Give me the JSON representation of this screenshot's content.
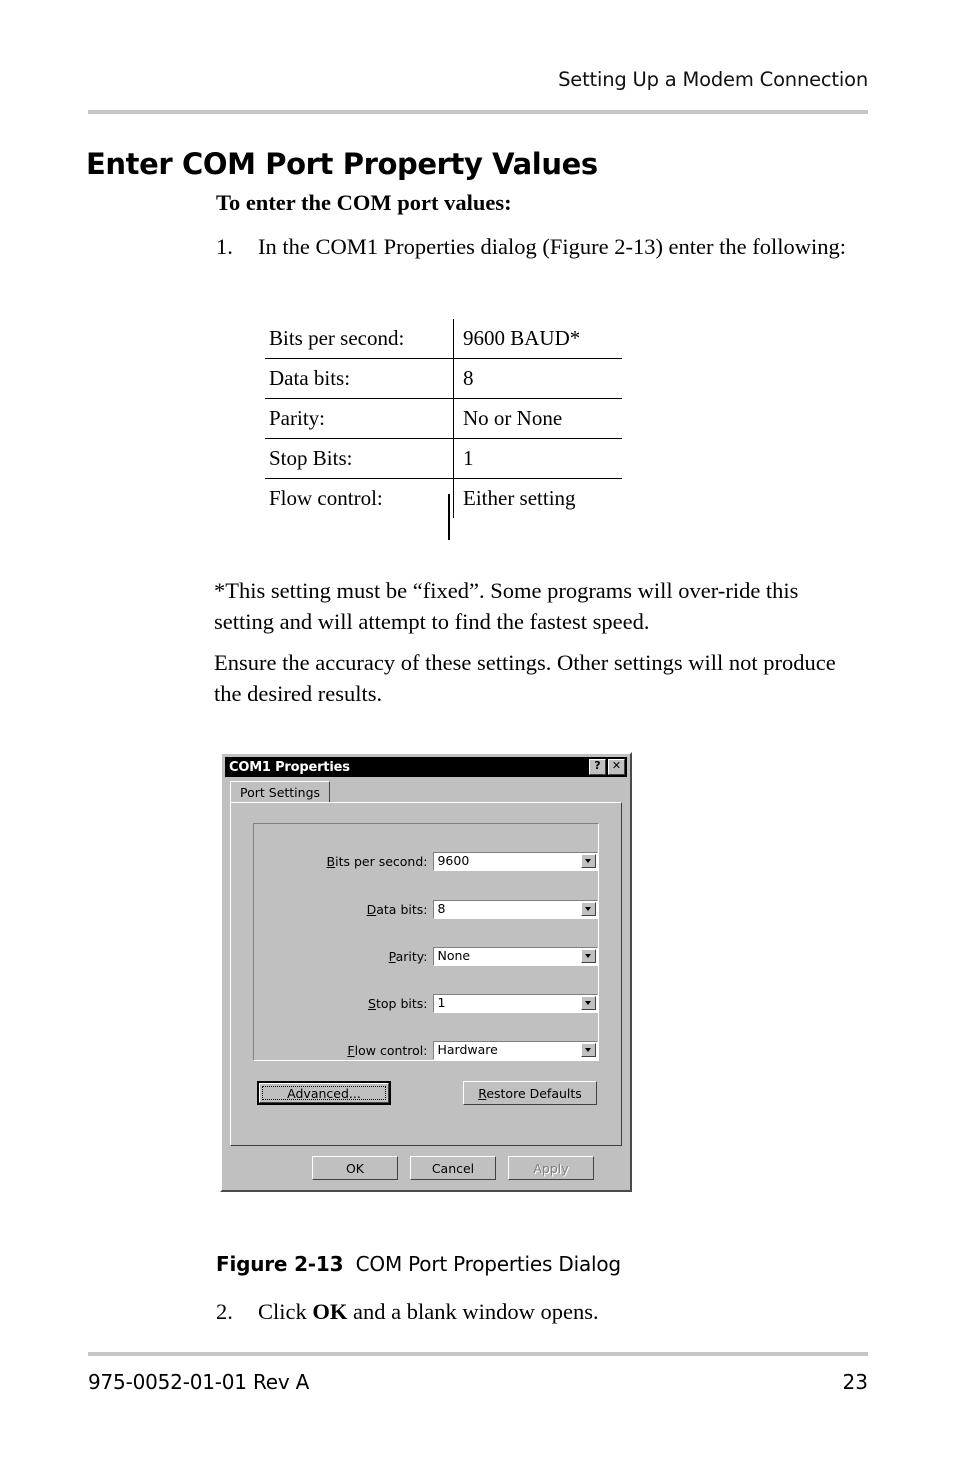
{
  "header": {
    "running_head": "Setting Up a Modem Connection"
  },
  "section": {
    "title": "Enter COM Port Property Values",
    "procedure_heading": "To enter the COM port values:"
  },
  "steps": [
    {
      "number": "1.",
      "text": "In the COM1 Properties dialog (Figure 2-13) enter the following:"
    },
    {
      "number": "2.",
      "text_before": "Click ",
      "bold": "OK",
      "text_after": " and a blank window opens."
    }
  ],
  "settings_table": {
    "rows": [
      {
        "label": "Bits per second:",
        "value": "9600 BAUD*"
      },
      {
        "label": "Data bits:",
        "value": "8"
      },
      {
        "label": "Parity:",
        "value": "No or None"
      },
      {
        "label": "Stop Bits:",
        "value": "1"
      },
      {
        "label": "Flow control:",
        "value": "Either setting"
      }
    ]
  },
  "paragraphs": {
    "footnote": "*This setting must be “fixed”. Some programs will over-ride this setting and will attempt to find the fastest speed.",
    "ensure": "Ensure the accuracy of these settings. Other settings will not produce the desired results."
  },
  "dialog": {
    "title": "COM1 Properties",
    "help_button": "?",
    "close_button": "✕",
    "tabs": [
      {
        "label": "Port Settings",
        "selected": true
      }
    ],
    "fields": [
      {
        "label_pre": "B",
        "label_accel": "B",
        "label_rest": "its per second:",
        "label_full": "Bits per second:",
        "value": "9600"
      },
      {
        "label_pre": "D",
        "label_accel": "D",
        "label_rest": "ata bits:",
        "label_full": "Data bits:",
        "value": "8"
      },
      {
        "label_pre": "P",
        "label_accel": "P",
        "label_rest": "arity:",
        "label_full": "Parity:",
        "value": "None"
      },
      {
        "label_pre": "S",
        "label_accel": "S",
        "label_rest": "top bits:",
        "label_full": "Stop bits:",
        "value": "1"
      },
      {
        "label_pre": "F",
        "label_accel": "F",
        "label_rest": "low control:",
        "label_full": "Flow control:",
        "value": "Hardware"
      }
    ],
    "buttons": {
      "advanced": "Advanced...",
      "restore_accel": "R",
      "restore_rest": "estore Defaults",
      "ok": "OK",
      "cancel": "Cancel",
      "apply": "Apply"
    }
  },
  "figure": {
    "label": "Figure 2-13",
    "title": "COM Port Properties Dialog"
  },
  "footer": {
    "doc_number": "975-0052-01-01 Rev A",
    "page_number": "23"
  },
  "colors": {
    "rule": "#c6c6c6",
    "dialog_face": "#c0c0c0",
    "titlebar": "#000000",
    "disabled_text": "#808080"
  }
}
